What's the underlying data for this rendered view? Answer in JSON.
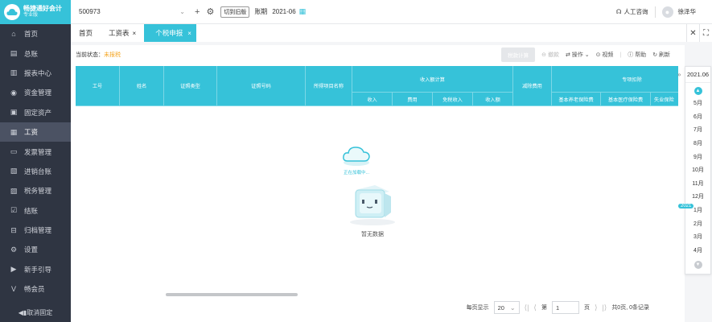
{
  "sidebar": {
    "logo_title": "畅捷通好会计",
    "logo_sub": "专业版",
    "items": [
      {
        "label": "首页",
        "icon": "home-icon"
      },
      {
        "label": "总账",
        "icon": "ledger-icon"
      },
      {
        "label": "报表中心",
        "icon": "chart-icon"
      },
      {
        "label": "资金管理",
        "icon": "money-icon"
      },
      {
        "label": "固定资产",
        "icon": "asset-icon"
      },
      {
        "label": "工资",
        "icon": "salary-icon"
      },
      {
        "label": "发票管理",
        "icon": "invoice-icon"
      },
      {
        "label": "进销台账",
        "icon": "inventory-icon"
      },
      {
        "label": "税务管理",
        "icon": "tax-icon"
      },
      {
        "label": "结账",
        "icon": "close-account-icon"
      },
      {
        "label": "归档管理",
        "icon": "archive-icon"
      },
      {
        "label": "设置",
        "icon": "gear-icon"
      },
      {
        "label": "新手引导",
        "icon": "guide-icon"
      },
      {
        "label": "畅会员",
        "icon": "vip-icon"
      }
    ],
    "active_index": 5,
    "unpin_label": "◀▮取消固定"
  },
  "topbar": {
    "account": "500973",
    "switch_old": "切到旧版",
    "period_label": "账期",
    "period_value": "2021-06",
    "support": "人工咨询",
    "user": "徐泽华"
  },
  "tabs": [
    {
      "label": "首页",
      "closable": false
    },
    {
      "label": "工资表",
      "closable": true
    },
    {
      "label": "个税申报",
      "closable": true,
      "active": true
    }
  ],
  "toolbar": {
    "status_label": "当前状态：",
    "status_value": "未报税",
    "calc_button": "税款计算",
    "withdraw": "撤款",
    "operate": "操作",
    "video": "视频",
    "help": "帮助",
    "refresh": "刷新"
  },
  "table": {
    "h_id": "工号",
    "h_name": "姓名",
    "h_cert_type": "证照类型",
    "h_cert_no": "证照号码",
    "h_income_item": "所得项目名称",
    "h_income_group": "收入额计算",
    "h_income": "收入",
    "h_expense": "费用",
    "h_taxfree": "免税收入",
    "h_income_amt": "收入额",
    "h_deduct_exp": "减除费用",
    "h_special": "专项扣除",
    "h_pension": "基本养老保险费",
    "h_medical": "基本医疗保险费",
    "h_unemp": "失业保险"
  },
  "loading_text": "正在加载中...",
  "empty_text": "暂无数据",
  "pager": {
    "per_page_label": "每页显示",
    "per_page": "20",
    "page_prefix": "第",
    "page_value": "1",
    "page_suffix": "页",
    "summary": "共0页, 0条记录"
  },
  "month_panel": {
    "current": "2021.06",
    "months": [
      "5月",
      "6月",
      "7月",
      "8月",
      "9月",
      "10月",
      "11月",
      "12月",
      "1月",
      "2月",
      "3月",
      "4月"
    ],
    "year_badge": "2021"
  },
  "colors": {
    "accent": "#36c2d9",
    "sidebar": "#2f3542",
    "warning": "#f5a623"
  }
}
